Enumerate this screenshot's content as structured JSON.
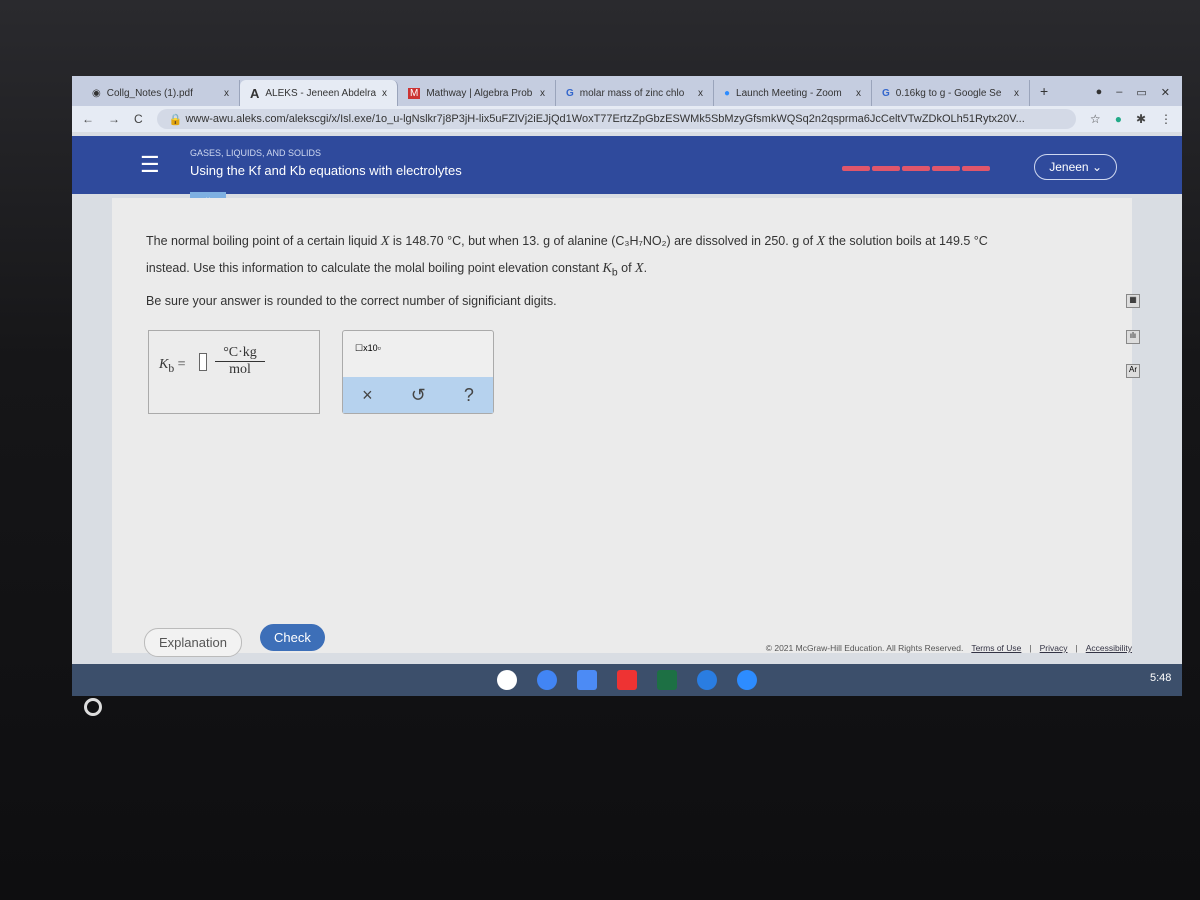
{
  "tabs": [
    {
      "label": "Collg_Notes (1).pdf",
      "icon": "drive-icon"
    },
    {
      "label": "ALEKS - Jeneen Abdelra",
      "icon": "aleks-icon",
      "active": true
    },
    {
      "label": "Mathway | Algebra Prob",
      "icon": "mathway-icon"
    },
    {
      "label": "molar mass of zinc chlo",
      "icon": "google-icon"
    },
    {
      "label": "Launch Meeting - Zoom",
      "icon": "zoom-icon"
    },
    {
      "label": "0.16kg to g - Google Se",
      "icon": "google-icon"
    }
  ],
  "close_glyph": "x",
  "new_tab": "+",
  "address": {
    "url": "www-awu.aleks.com/alekscgi/x/Isl.exe/1o_u-lgNslkr7j8P3jH-lix5uFZlVj2iEJjQd1WoxT77ErtzZpGbzESWMk5SbMzyGfsmkWQSq2n2qsprma6JcCeltVTwZDkOLh51Rytx20V..."
  },
  "header": {
    "topic": "GASES, LIQUIDS, AND SOLIDS",
    "title": "Using the Kf and Kb equations with electrolytes",
    "user": "Jeneen",
    "progress_segments": 5
  },
  "question": {
    "p1a": "The normal boiling point of a certain liquid ",
    "X": "X",
    "p1b": " is 148.70 °C, but when 13. g of alanine (C₃H₇NO₂) are dissolved in 250. g of ",
    "p1c": " the solution boils at 149.5 °C",
    "p2a": "instead. Use this information to calculate the molal boiling point elevation constant ",
    "Kb": "K",
    "b": "b",
    "p2b": " of ",
    "p2c": ".",
    "p3": "Be sure your answer is rounded to the correct number of significiant digits."
  },
  "answer": {
    "lhs": "K",
    "sub": "b",
    "eq": "=",
    "unit_num": "°C·kg",
    "unit_den": "mol",
    "value": ""
  },
  "palette": {
    "x10": "x10",
    "clear": "×",
    "undo": "↺",
    "help": "?"
  },
  "buttons": {
    "explanation": "Explanation",
    "check": "Check"
  },
  "footer": {
    "copyright": "© 2021 McGraw-Hill Education. All Rights Reserved.",
    "terms": "Terms of Use",
    "privacy": "Privacy",
    "accessibility": "Accessibility"
  },
  "clock": "5:48",
  "colors": {
    "header": "#2f4a9c",
    "check": "#3d6fb8",
    "progress": "#e0566a"
  }
}
